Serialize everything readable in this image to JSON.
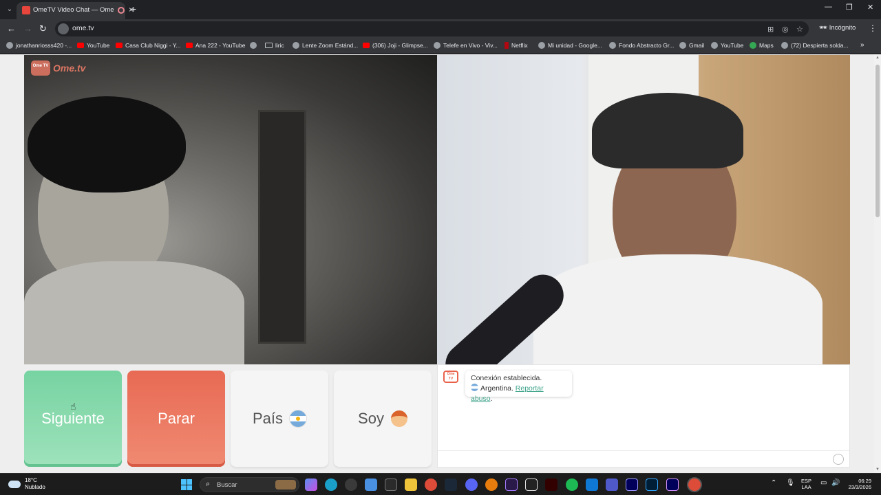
{
  "browser": {
    "tab_title": "OmeTV Video Chat — Ome.tv",
    "url": "ome.tv",
    "profile_label": "Incógnito",
    "bookmarks": [
      {
        "label": "jonathanriosss420 -...",
        "icon": "globe-icon"
      },
      {
        "label": "YouTube",
        "icon": "youtube-icon"
      },
      {
        "label": "Casa Club Niggi - Y...",
        "icon": "youtube-icon"
      },
      {
        "label": "Ana 222 - YouTube",
        "icon": "youtube-icon"
      },
      {
        "label": "",
        "icon": "globe-icon"
      },
      {
        "label": "liric",
        "icon": "folder-icon"
      },
      {
        "label": "Lente Zoom Estánd...",
        "icon": "globe-icon"
      },
      {
        "label": "(306) Joji - Glimpse...",
        "icon": "youtube-icon"
      },
      {
        "label": "Telefe en Vivo - Viv...",
        "icon": "globe-icon"
      },
      {
        "label": "Netflix",
        "icon": "netflix-icon"
      },
      {
        "label": "Mi unidad - Google...",
        "icon": "globe-icon"
      },
      {
        "label": "Fondo Abstracto Gr...",
        "icon": "globe-icon"
      },
      {
        "label": "Gmail",
        "icon": "globe-icon"
      },
      {
        "label": "YouTube",
        "icon": "globe-icon"
      },
      {
        "label": "Maps",
        "icon": "maps-icon"
      },
      {
        "label": "(72) Despierta solda...",
        "icon": "globe-icon"
      }
    ]
  },
  "page": {
    "brand": "Ome.tv",
    "logo_badge": "Ome TV",
    "buttons": {
      "next": "Siguiente",
      "stop": "Parar",
      "country": "País",
      "gender": "Soy"
    },
    "chat": {
      "status": "Conexión establecida.",
      "country": "Argentina.",
      "report_link": "Reportar abuso",
      "report_suffix": "."
    }
  },
  "taskbar": {
    "weather_temp": "18°C",
    "weather_desc": "Nublado",
    "search_label": "Buscar",
    "lang_top": "ESP",
    "lang_bottom": "LAA",
    "time": "06:29",
    "date": "23/3/2026"
  },
  "colors": {
    "next_button": "#77d3a2",
    "stop_button": "#e86a54",
    "report_link": "#3ea38a",
    "brand": "#ec7c68"
  }
}
